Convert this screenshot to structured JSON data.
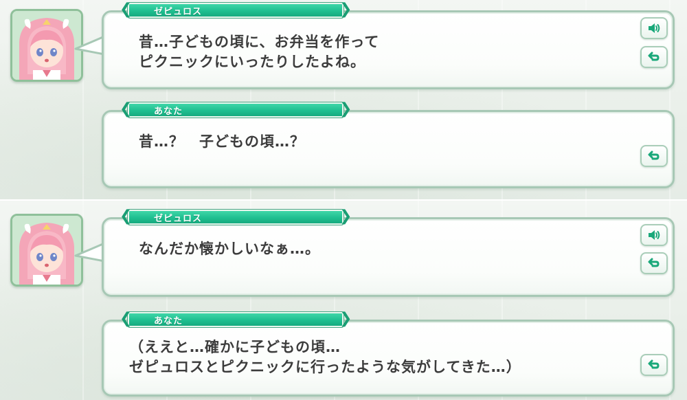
{
  "messages": [
    {
      "speaker": "ゼピュロス",
      "text": "昔…子どもの頃に、お弁当を作って\nピクニックにいったりしたよね。",
      "has_voice": true
    },
    {
      "speaker": "あなた",
      "text": "昔…？　子どもの頃…？",
      "has_voice": false
    },
    {
      "speaker": "ゼピュロス",
      "text": "なんだか懐かしいなぁ…。",
      "has_voice": true
    },
    {
      "speaker": "あなた",
      "text": "（ええと…確かに子どもの頃…\nゼピュロスとピクニックに行ったような気がしてきた…）",
      "has_voice": false
    }
  ],
  "icons": {
    "voice": "speaker-icon",
    "replay": "replay-icon"
  },
  "colors": {
    "nameplate": "#1fbf90",
    "bubble_border": "#a7c8b5",
    "text": "#3c3c3c",
    "icon_green": "#1aa87a"
  }
}
